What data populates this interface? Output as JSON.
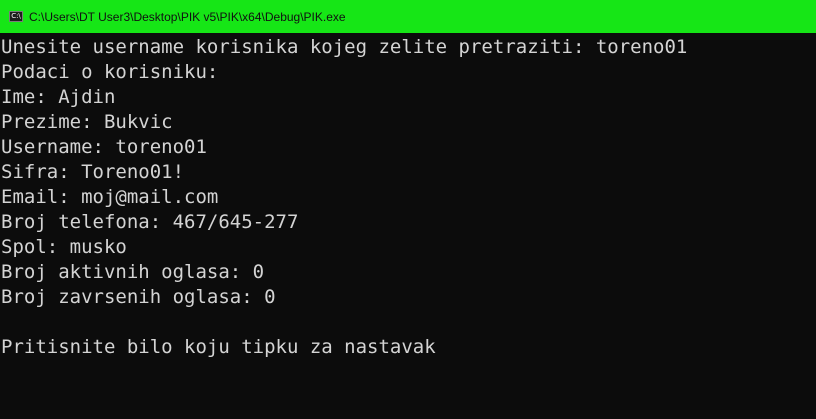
{
  "window": {
    "title": "C:\\Users\\DT User3\\Desktop\\PIK v5\\PIK\\x64\\Debug\\PIK.exe",
    "icon": "console-app-icon",
    "titlebar_color": "#16e616"
  },
  "console": {
    "background": "#0c0c0c",
    "text_color": "#d4d4d4",
    "lines": [
      "Unesite username korisnika kojeg zelite pretraziti: toreno01",
      "Podaci o korisniku:",
      "Ime: Ajdin",
      "Prezime: Bukvic",
      "Username: toreno01",
      "Sifra: Toreno01!",
      "Email: moj@mail.com",
      "Broj telefona: 467/645-277",
      "Spol: musko",
      "Broj aktivnih oglasa: 0",
      "Broj zavrsenih oglasa: 0",
      "",
      "Pritisnite bilo koju tipku za nastavak"
    ]
  }
}
